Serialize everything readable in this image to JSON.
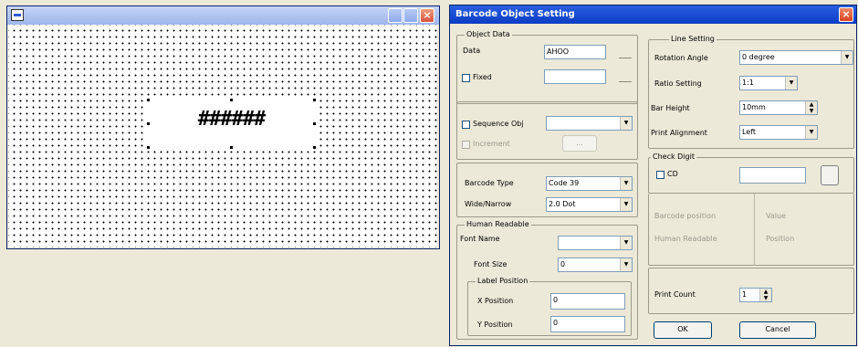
{
  "left_window": {
    "barcode_text": "######"
  },
  "dialog": {
    "title": "Barcode Object Setting",
    "left": {
      "group1": {
        "caption": "Object Data",
        "data_label": "Data",
        "data_value": "AHOO",
        "fixed_label": "Fixed",
        "fixed_value": ""
      },
      "group2": {
        "caption": "",
        "sequence_label": "Sequence Obj",
        "sequence_value": "",
        "increment_label": "Increment",
        "increment_button": "..."
      },
      "group3": {
        "type_label": "Barcode Type",
        "type_value": "Code 39",
        "width_label": "Wide/Narrow",
        "width_value": "2.0 Dot"
      },
      "group4": {
        "caption": "Human Readable",
        "font_label": "Font Name",
        "font_value": "",
        "size_label": "Font Size",
        "size_value": "0",
        "sub_caption": "Label Position",
        "x_label": "X Position",
        "x_value": "0",
        "y_label": "Y Position",
        "y_value": "0"
      }
    },
    "right": {
      "settings": {
        "caption": "Line Setting",
        "f1_label": "Rotation Angle",
        "f1_value": "0 degree",
        "f2_label": "Ratio Setting",
        "f2_value": "1:1",
        "f3_label": "Bar Height",
        "f3_value": "10mm",
        "f4_label": "Print Alignment",
        "f4_value": "Left"
      },
      "check": {
        "caption": "Check Digit",
        "chk_label": "CD",
        "value": "",
        "button": ""
      },
      "mode": {
        "m1": "Barcode position",
        "m2": "Value",
        "m3": "Human Readable",
        "m4": "Position"
      },
      "bottom": {
        "label": "Print Count",
        "value": "1",
        "ok": "OK",
        "cancel": "Cancel"
      }
    }
  }
}
